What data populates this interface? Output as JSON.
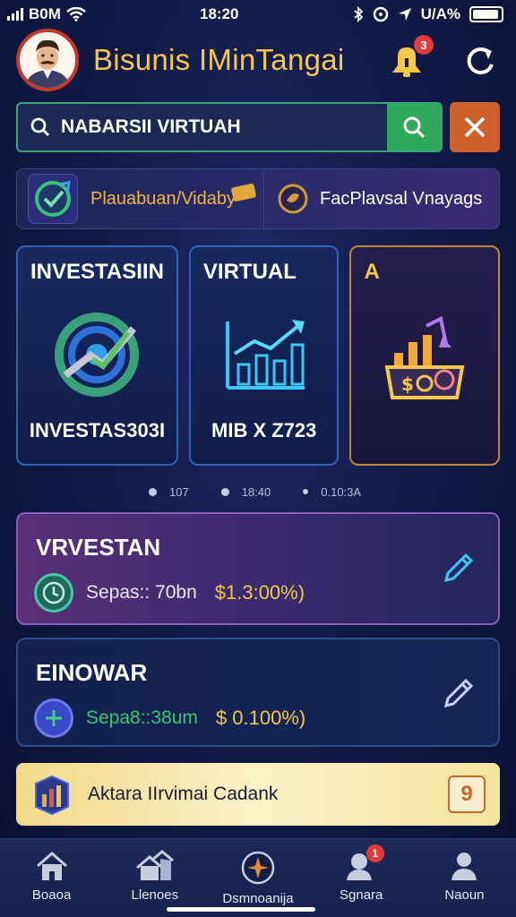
{
  "status_bar": {
    "carrier": "B0M",
    "time": "18:20",
    "battery": "U/A%"
  },
  "header": {
    "title": "Bisunis IMinTangai",
    "notification_count": "3"
  },
  "search": {
    "value": "NABARSII VIRTUAH"
  },
  "filters": {
    "primary_label": "Plauabuan/Vidaby",
    "secondary_label": "FacPlavsal Vnayags"
  },
  "cards": [
    {
      "title": "INVESTASIIN",
      "footer": "INVESTAS303I"
    },
    {
      "title": "VIRTUAL",
      "footer": "MIB X Z723"
    },
    {
      "title": "A",
      "footer": ""
    }
  ],
  "pager": {
    "items": [
      "107",
      "18:40",
      "0.10:3A"
    ]
  },
  "investments": [
    {
      "title": "VRVESTAN",
      "subtitle": "Sepas:: 70bn",
      "value": "$1.3:00%)",
      "accent": "#f3c84b"
    },
    {
      "title": "EINOWAR",
      "subtitle": "Sepa8::38um",
      "value": "$ 0.100%)",
      "accent": "#37c870"
    }
  ],
  "promo": {
    "text": "Aktara IIrvimai Cadank",
    "icon_glyph": "9"
  },
  "bottom_nav": [
    {
      "label": "Boaoa",
      "icon": "home-icon"
    },
    {
      "label": "Llenoes",
      "icon": "houses-icon"
    },
    {
      "label": "Dsmnoanija",
      "icon": "compass-icon"
    },
    {
      "label": "Sgnara",
      "icon": "user-help-icon",
      "badge": "1"
    },
    {
      "label": "Naoun",
      "icon": "profile-icon"
    }
  ],
  "colors": {
    "accent_gold": "#f3c84b",
    "accent_green": "#2faa5c",
    "accent_orange": "#d0602a",
    "background": "#121a48"
  }
}
